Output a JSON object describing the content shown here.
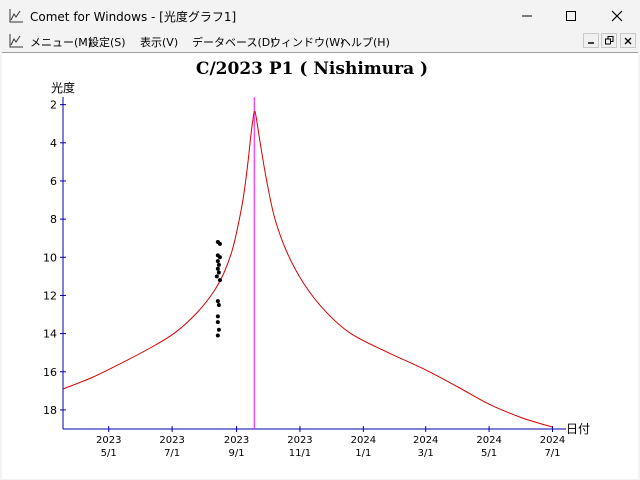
{
  "window": {
    "title": "Comet for Windows - [光度グラフ1]",
    "icon": "chart-icon"
  },
  "menu": {
    "items": [
      "メニュー(M)",
      "設定(S)",
      "表示(V)",
      "データベース(D)",
      "ウィンドウ(W)",
      "ヘルプ(H)"
    ]
  },
  "colors": {
    "curve": "#d40000",
    "marker": "#ff00ff",
    "axis": "#0000aa",
    "points": "#000000"
  },
  "chart_data": {
    "type": "line",
    "title": "C/2023 P1 ( Nishimura )",
    "ylabel": "光度",
    "xlabel": "日付",
    "y_reversed": true,
    "ylim": [
      19,
      1.6
    ],
    "yticks": [
      2,
      4,
      6,
      8,
      10,
      12,
      14,
      16,
      18
    ],
    "xlim": [
      "2023-03-18",
      "2024-07-14"
    ],
    "xticks": [
      {
        "date": "2023-05-01",
        "year": "2023",
        "md": "5/1"
      },
      {
        "date": "2023-07-01",
        "year": "2023",
        "md": "7/1"
      },
      {
        "date": "2023-09-01",
        "year": "2023",
        "md": "9/1"
      },
      {
        "date": "2023-11-01",
        "year": "2023",
        "md": "11/1"
      },
      {
        "date": "2024-01-01",
        "year": "2024",
        "md": "1/1"
      },
      {
        "date": "2024-03-01",
        "year": "2024",
        "md": "3/1"
      },
      {
        "date": "2024-05-01",
        "year": "2024",
        "md": "5/1"
      },
      {
        "date": "2024-07-01",
        "year": "2024",
        "md": "7/1"
      }
    ],
    "marker_date": "2023-09-18",
    "series": [
      {
        "kind": "predicted",
        "points": [
          [
            "2023-03-18",
            16.9
          ],
          [
            "2023-04-15",
            16.3
          ],
          [
            "2023-05-15",
            15.5
          ],
          [
            "2023-06-15",
            14.6
          ],
          [
            "2023-07-05",
            13.9
          ],
          [
            "2023-07-25",
            12.9
          ],
          [
            "2023-08-10",
            11.8
          ],
          [
            "2023-08-20",
            10.8
          ],
          [
            "2023-08-28",
            9.6
          ],
          [
            "2023-09-03",
            8.2
          ],
          [
            "2023-09-08",
            6.7
          ],
          [
            "2023-09-12",
            5.0
          ],
          [
            "2023-09-15",
            3.5
          ],
          [
            "2023-09-18",
            2.4
          ],
          [
            "2023-09-20",
            2.7
          ],
          [
            "2023-09-24",
            4.1
          ],
          [
            "2023-09-30",
            6.0
          ],
          [
            "2023-10-08",
            8.0
          ],
          [
            "2023-10-20",
            9.8
          ],
          [
            "2023-11-05",
            11.4
          ],
          [
            "2023-11-25",
            12.8
          ],
          [
            "2023-12-20",
            14.0
          ],
          [
            "2024-01-25",
            15.0
          ],
          [
            "2024-03-01",
            15.9
          ],
          [
            "2024-04-01",
            16.8
          ],
          [
            "2024-05-01",
            17.7
          ],
          [
            "2024-06-01",
            18.4
          ],
          [
            "2024-07-01",
            18.9
          ]
        ]
      },
      {
        "kind": "observed",
        "points": [
          [
            "2023-08-14",
            9.2
          ],
          [
            "2023-08-16",
            9.3
          ],
          [
            "2023-08-14",
            9.9
          ],
          [
            "2023-08-16",
            10.0
          ],
          [
            "2023-08-14",
            10.2
          ],
          [
            "2023-08-15",
            10.4
          ],
          [
            "2023-08-14",
            10.6
          ],
          [
            "2023-08-15",
            10.8
          ],
          [
            "2023-08-13",
            11.0
          ],
          [
            "2023-08-16",
            11.2
          ],
          [
            "2023-08-14",
            12.3
          ],
          [
            "2023-08-15",
            12.5
          ],
          [
            "2023-08-14",
            13.1
          ],
          [
            "2023-08-14",
            13.4
          ],
          [
            "2023-08-15",
            13.8
          ],
          [
            "2023-08-14",
            14.1
          ]
        ]
      }
    ]
  }
}
